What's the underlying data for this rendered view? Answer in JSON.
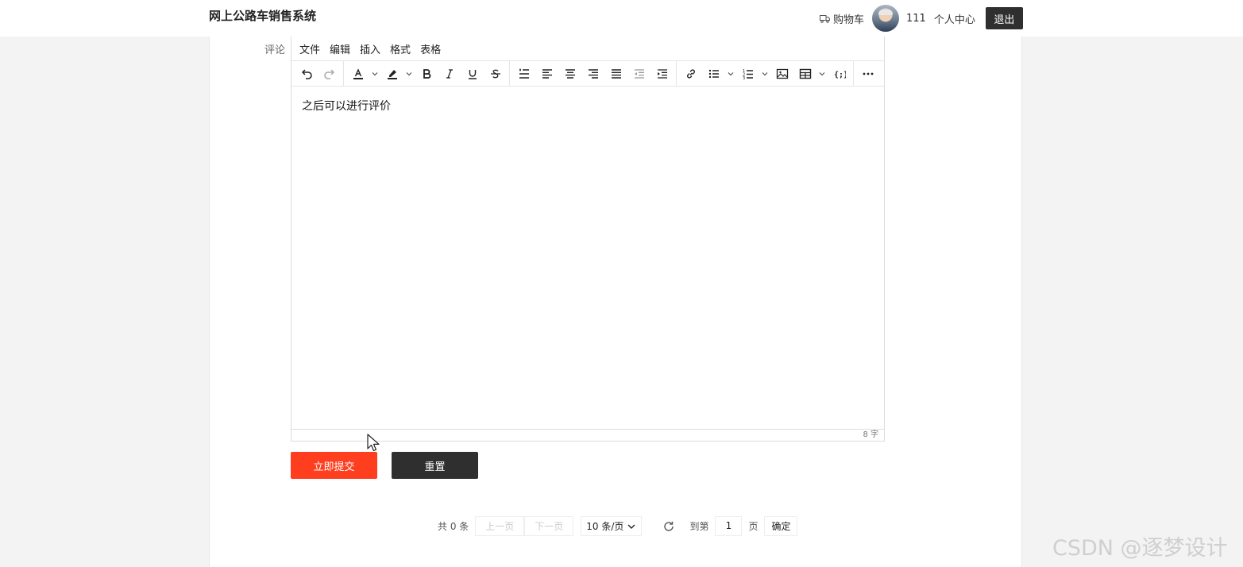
{
  "header": {
    "brand": "网上公路车销售系统",
    "cart_label": "购物车",
    "username": "111",
    "user_center": "个人中心",
    "logout": "退出"
  },
  "form": {
    "comment_label": "评论",
    "menubar": [
      "文件",
      "编辑",
      "插入",
      "格式",
      "表格"
    ],
    "editor_text": "之后可以进行评价",
    "char_count": "8 字",
    "submit_label": "立即提交",
    "reset_label": "重置"
  },
  "pagination": {
    "total": "共 0 条",
    "prev": "上一页",
    "next": "下一页",
    "limit": "10 条/页",
    "goto_prefix": "到第",
    "goto_value": "1",
    "goto_suffix": "页",
    "confirm": "确定"
  },
  "watermark": "CSDN @逐梦设计"
}
